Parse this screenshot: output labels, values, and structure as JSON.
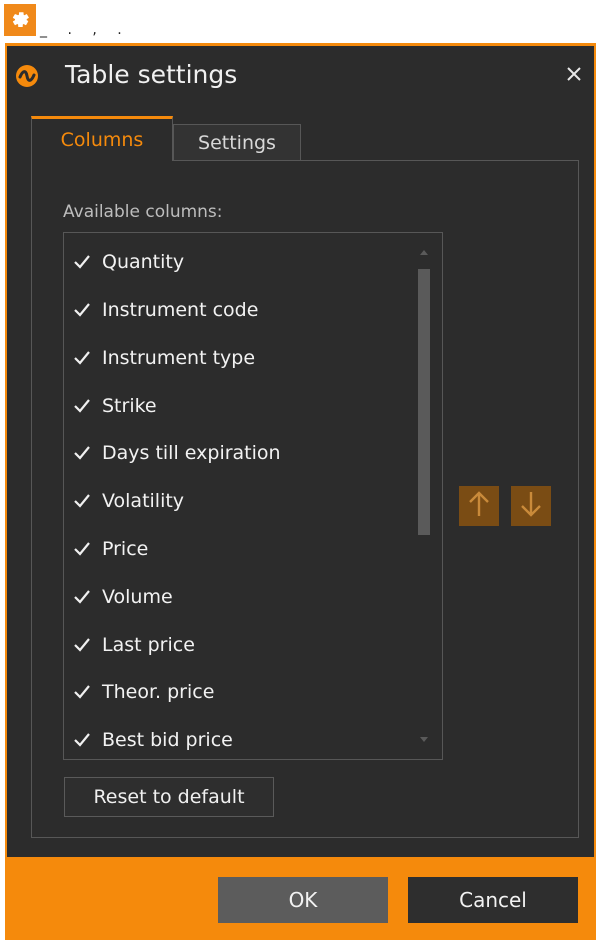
{
  "top": {
    "icon": "gear-icon",
    "residue_text": "_ . , ."
  },
  "dialog": {
    "title": "Table settings",
    "title_icon": "logo-icon",
    "close_icon": "close-icon",
    "accent_color": "#f58a0c",
    "tabs": [
      {
        "label": "Columns",
        "active": true
      },
      {
        "label": "Settings",
        "active": false
      }
    ],
    "available_label": "Available columns:",
    "columns": [
      {
        "label": "Quantity",
        "checked": true
      },
      {
        "label": "Instrument code",
        "checked": true
      },
      {
        "label": "Instrument type",
        "checked": true
      },
      {
        "label": "Strike",
        "checked": true
      },
      {
        "label": "Days till expiration",
        "checked": true
      },
      {
        "label": "Volatility",
        "checked": true
      },
      {
        "label": "Price",
        "checked": true
      },
      {
        "label": "Volume",
        "checked": true
      },
      {
        "label": "Last price",
        "checked": true
      },
      {
        "label": "Theor. price",
        "checked": true
      },
      {
        "label": "Best bid price",
        "checked": true
      }
    ],
    "move_up_icon": "arrow-up-icon",
    "move_down_icon": "arrow-down-icon",
    "reset_label": "Reset to default",
    "ok_label": "OK",
    "cancel_label": "Cancel"
  }
}
